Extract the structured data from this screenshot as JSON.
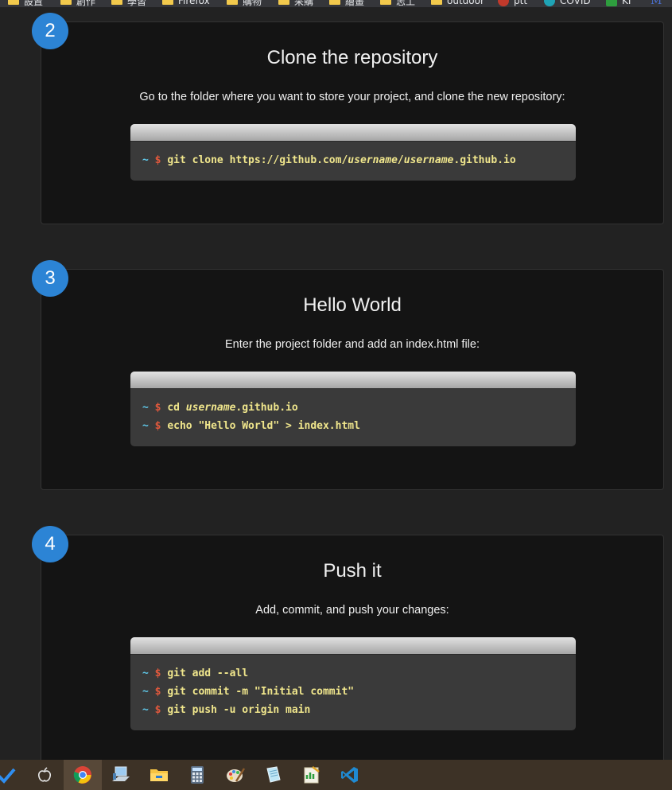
{
  "bookmarks": [
    {
      "label": "設置",
      "icon": "folder-icon"
    },
    {
      "label": "創作",
      "icon": "folder-icon"
    },
    {
      "label": "學習",
      "icon": "folder-icon"
    },
    {
      "label": "Firefox",
      "icon": "folder-icon"
    },
    {
      "label": "購物",
      "icon": "folder-icon"
    },
    {
      "label": "采購",
      "icon": "folder-icon"
    },
    {
      "label": "繪畫",
      "icon": "folder-icon"
    },
    {
      "label": "志工",
      "icon": "folder-icon"
    },
    {
      "label": "outdoor",
      "icon": "folder-icon"
    },
    {
      "label": "ptt",
      "icon": "ptt-icon"
    },
    {
      "label": "COVID",
      "icon": "covid-icon"
    },
    {
      "label": "KI",
      "icon": "ki-icon"
    },
    {
      "label": "M",
      "icon": "m-icon"
    }
  ],
  "steps": [
    {
      "number": "2",
      "title": "Clone the repository",
      "description": "Go to the folder where you want to store your project, and clone the new repository:",
      "lines": [
        {
          "tilde": "~",
          "dollar": "$",
          "cmd": "git clone https://github.com/",
          "em1": "username",
          "mid": "/",
          "em2": "username",
          "tail": ".github.io"
        }
      ]
    },
    {
      "number": "3",
      "title": "Hello World",
      "description": "Enter the project folder and add an index.html file:",
      "lines": [
        {
          "tilde": "~",
          "dollar": "$",
          "cmd": "cd ",
          "em1": "username",
          "tail": ".github.io"
        },
        {
          "tilde": "~",
          "dollar": "$",
          "cmd": "echo \"Hello World\" > index.html"
        }
      ]
    },
    {
      "number": "4",
      "title": "Push it",
      "description": "Add, commit, and push your changes:",
      "lines": [
        {
          "tilde": "~",
          "dollar": "$",
          "cmd": "git add --all"
        },
        {
          "tilde": "~",
          "dollar": "$",
          "cmd": "git commit -m \"Initial commit\""
        },
        {
          "tilde": "~",
          "dollar": "$",
          "cmd": "git push -u origin main"
        }
      ]
    }
  ],
  "taskbar": {
    "items": [
      "checkmark-icon",
      "apple-icon",
      "chrome-icon",
      "computer-icon",
      "file-explorer-icon",
      "calculator-icon",
      "paint-icon",
      "notepad-icon",
      "spreadsheet-icon",
      "vscode-icon"
    ],
    "active": "chrome-icon"
  }
}
